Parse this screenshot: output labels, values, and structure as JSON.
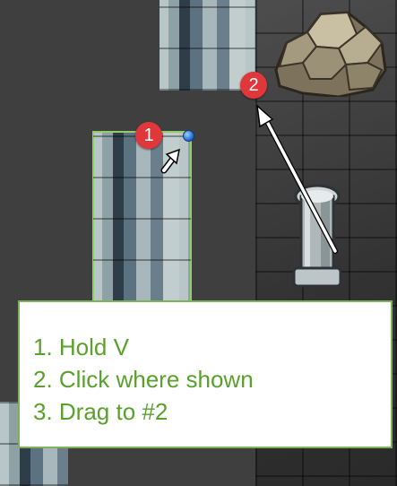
{
  "editor": {
    "colors": {
      "background": "#3f3f3f",
      "selection_outline": "#8fcf6a",
      "badge": "#e0373b",
      "instruction_text": "#5aa02c",
      "instruction_border": "#7ab35a"
    },
    "badges": {
      "step1": "1",
      "step2": "2"
    },
    "instructions": {
      "line1": "1. Hold V",
      "line2": "2. Click where shown",
      "line3": "3. Drag to #2"
    }
  }
}
